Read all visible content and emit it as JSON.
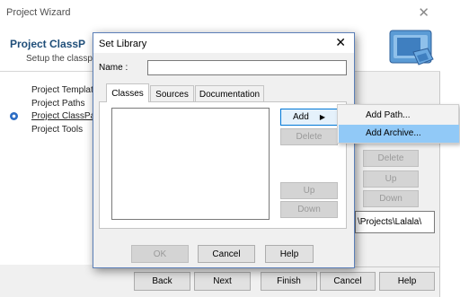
{
  "wizard": {
    "title": "Project Wizard",
    "close_glyph": "✕",
    "heading": "Project ClassP",
    "subheading": "Setup the classpa",
    "logo_icon": "project-folders-icon",
    "nav": [
      {
        "label": "Project Template"
      },
      {
        "label": "Project Paths"
      },
      {
        "label": "Project ClassPat"
      },
      {
        "label": "Project Tools"
      }
    ],
    "right_buttons": {
      "delete": "Delete",
      "up": "Up",
      "down": "Down"
    },
    "path_value": "\\Projects\\Lalala\\",
    "footer": {
      "back": "Back",
      "next": "Next",
      "finish": "Finish",
      "cancel": "Cancel",
      "help": "Help"
    }
  },
  "dialog": {
    "title": "Set Library",
    "close_glyph": "✕",
    "name_label": "Name :",
    "name_value": "",
    "tabs": [
      {
        "label": "Classes",
        "active": true
      },
      {
        "label": "Sources",
        "active": false
      },
      {
        "label": "Documentation",
        "active": false
      }
    ],
    "buttons": {
      "add": "Add",
      "add_arrow": "▶",
      "delete": "Delete",
      "up": "Up",
      "down": "Down"
    },
    "footer": {
      "ok": "OK",
      "cancel": "Cancel",
      "help": "Help"
    }
  },
  "menu": {
    "items": [
      {
        "label": "Add Path..."
      },
      {
        "label": "Add Archive..."
      }
    ]
  },
  "colors": {
    "heading": "#1f4e79",
    "menu_highlight": "#91c9f7",
    "dialog_border": "#5b7fb8"
  }
}
